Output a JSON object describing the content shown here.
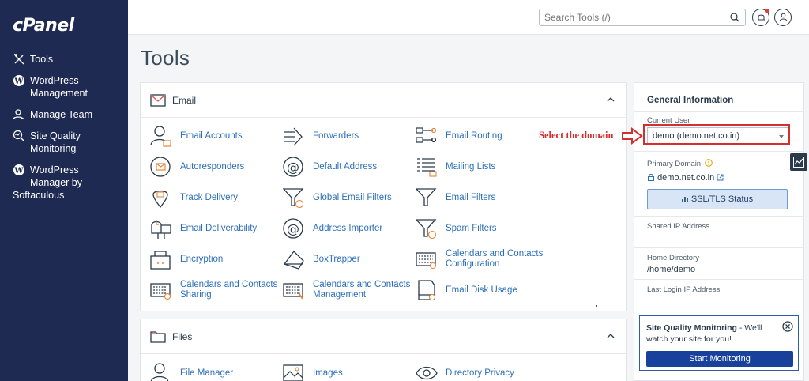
{
  "sidebar": {
    "logo": "cPanel",
    "items": [
      {
        "name": "tools",
        "line1": "Tools",
        "line2": ""
      },
      {
        "name": "wordpress-management",
        "line1": "WordPress",
        "line2": "Management"
      },
      {
        "name": "manage-team",
        "line1": "Manage Team",
        "line2": ""
      },
      {
        "name": "site-quality-monitoring",
        "line1": "Site Quality",
        "line2": "Monitoring"
      },
      {
        "name": "wordpress-manager-softaculous",
        "line1": "WordPress",
        "line2": "Manager by",
        "line3": "Softaculous"
      }
    ]
  },
  "topbar": {
    "search_placeholder": "Search Tools (/)"
  },
  "page_title": "Tools",
  "email_panel": {
    "title": "Email",
    "tools": [
      "Email Accounts",
      "Forwarders",
      "Email Routing",
      "Autoresponders",
      "Default Address",
      "Mailing Lists",
      "Track Delivery",
      "Global Email Filters",
      "Email Filters",
      "Email Deliverability",
      "Address Importer",
      "Spam Filters",
      "Encryption",
      "BoxTrapper",
      "Calendars and Contacts Configuration",
      "Calendars and Contacts Sharing",
      "Calendars and Contacts Management",
      "Email Disk Usage"
    ]
  },
  "files_panel": {
    "title": "Files",
    "tools": [
      "File Manager",
      "Images",
      "Directory Privacy"
    ]
  },
  "general_info": {
    "title": "General Information",
    "current_user_label": "Current User",
    "current_user_value": "demo (demo.net.co.in)",
    "primary_domain_label": "Primary Domain",
    "primary_domain_value": "demo.net.co.in",
    "ssl_button": "SSL/TLS Status",
    "shared_ip_label": "Shared IP Address",
    "home_dir_label": "Home Directory",
    "home_dir_value": "/home/demo",
    "last_login_label": "Last Login IP Address"
  },
  "sqm_card": {
    "title": "Site Quality Monitoring",
    "text": " - We'll watch your site for you!",
    "button": "Start Monitoring"
  },
  "annotation": "Select the domain",
  "colors": {
    "sidebar_bg": "#1e2a52",
    "link": "#2c6fb8",
    "primary_button": "#17419b",
    "annotation": "#d32f2f"
  }
}
